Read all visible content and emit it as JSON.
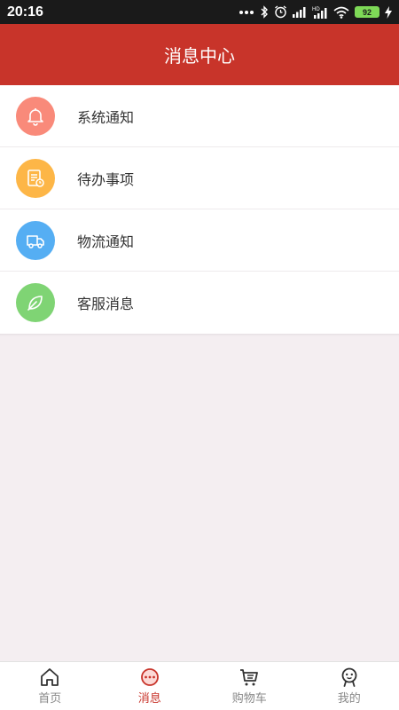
{
  "status_bar": {
    "time": "20:16",
    "battery": "92",
    "icons": [
      "more-dots-icon",
      "bluetooth-icon",
      "alarm-icon",
      "signal-icon",
      "hd-signal-icon",
      "wifi-icon",
      "battery-icon",
      "charging-icon"
    ]
  },
  "header": {
    "title": "消息中心",
    "color": "#c8342a"
  },
  "messages": [
    {
      "label": "系统通知",
      "icon": "bell-icon",
      "color": "#f98a7a"
    },
    {
      "label": "待办事项",
      "icon": "todo-list-icon",
      "color": "#fdb647"
    },
    {
      "label": "物流通知",
      "icon": "truck-icon",
      "color": "#55aef3"
    },
    {
      "label": "客服消息",
      "icon": "leaf-icon",
      "color": "#7fd474"
    }
  ],
  "tabbar": {
    "tabs": [
      {
        "label": "首页",
        "icon": "home-icon",
        "active": false
      },
      {
        "label": "消息",
        "icon": "chat-icon",
        "active": true
      },
      {
        "label": "购物车",
        "icon": "cart-icon",
        "active": false
      },
      {
        "label": "我的",
        "icon": "user-icon",
        "active": false
      }
    ]
  }
}
